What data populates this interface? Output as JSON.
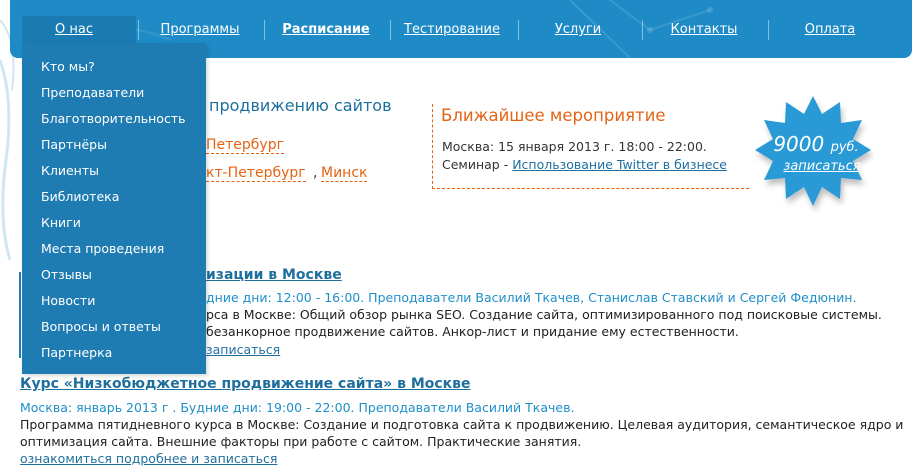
{
  "nav": {
    "items": [
      {
        "label": "О нас"
      },
      {
        "label": "Программы"
      },
      {
        "label": "Расписание"
      },
      {
        "label": "Тестирование"
      },
      {
        "label": "Услуги"
      },
      {
        "label": "Контакты"
      },
      {
        "label": "Оплата"
      }
    ]
  },
  "dropdown": {
    "items": [
      {
        "label": "Кто мы?"
      },
      {
        "label": "Преподаватели"
      },
      {
        "label": "Благотворительность"
      },
      {
        "label": "Партнёры"
      },
      {
        "label": "Клиенты"
      },
      {
        "label": "Библиотека"
      },
      {
        "label": "Книги"
      },
      {
        "label": "Места проведения"
      },
      {
        "label": "Отзывы"
      },
      {
        "label": "Новости"
      },
      {
        "label": "Вопросы и ответы"
      },
      {
        "label": "Партнерка"
      }
    ]
  },
  "headline": {
    "text": "продвижению сайтов",
    "city1": "Петербург",
    "city2": "кт-Петербург",
    "comma": ",",
    "city3": "Минск"
  },
  "event": {
    "title": "Ближайшее мероприятие",
    "line1": "Москва: 15 января 2013 г. 18:00 - 22:00.",
    "prefix": "Семинар - ",
    "link": "Использование Twitter в бизнесе"
  },
  "price": {
    "amount": "9000",
    "unit": "руб.",
    "action": "записаться"
  },
  "courses": [
    {
      "title": "изации в Москве",
      "when": "дние дни: 12:00 - 16:00. Преподаватели Василий Ткачев, Станислав Ставский и Сергей Федюнин.",
      "desc1": "рса в Москве: Общий обзор рынка SEO. Создание сайта, оптимизированного под поисковые системы.",
      "desc2": "безанкорное продвижение сайтов. Анкор-лист и придание ему естественности.",
      "more": "записаться"
    },
    {
      "title": "Курс «Низкобюджетное продвижение сайта» в Москве",
      "when": "Москва: январь 2013 г  . Будние дни: 19:00 - 22:00. Преподаватели Василий Ткачев.",
      "desc1": "Программа пятидневного курса в Москве: Создание и подготовка сайта к продвижению. Целевая аудитория, семантическое ядро и",
      "desc2": "оптимизация сайта. Внешние факторы при работе с сайтом. Практические занятия.",
      "more": "ознакомиться подробнее и записаться"
    }
  ],
  "colors": {
    "nav_bg": "#1e8bc6",
    "dropdown_bg": "#1e7cb3",
    "accent_orange": "#e56414",
    "link_blue": "#1f6f9e",
    "star_blue": "#2a9ad6"
  }
}
